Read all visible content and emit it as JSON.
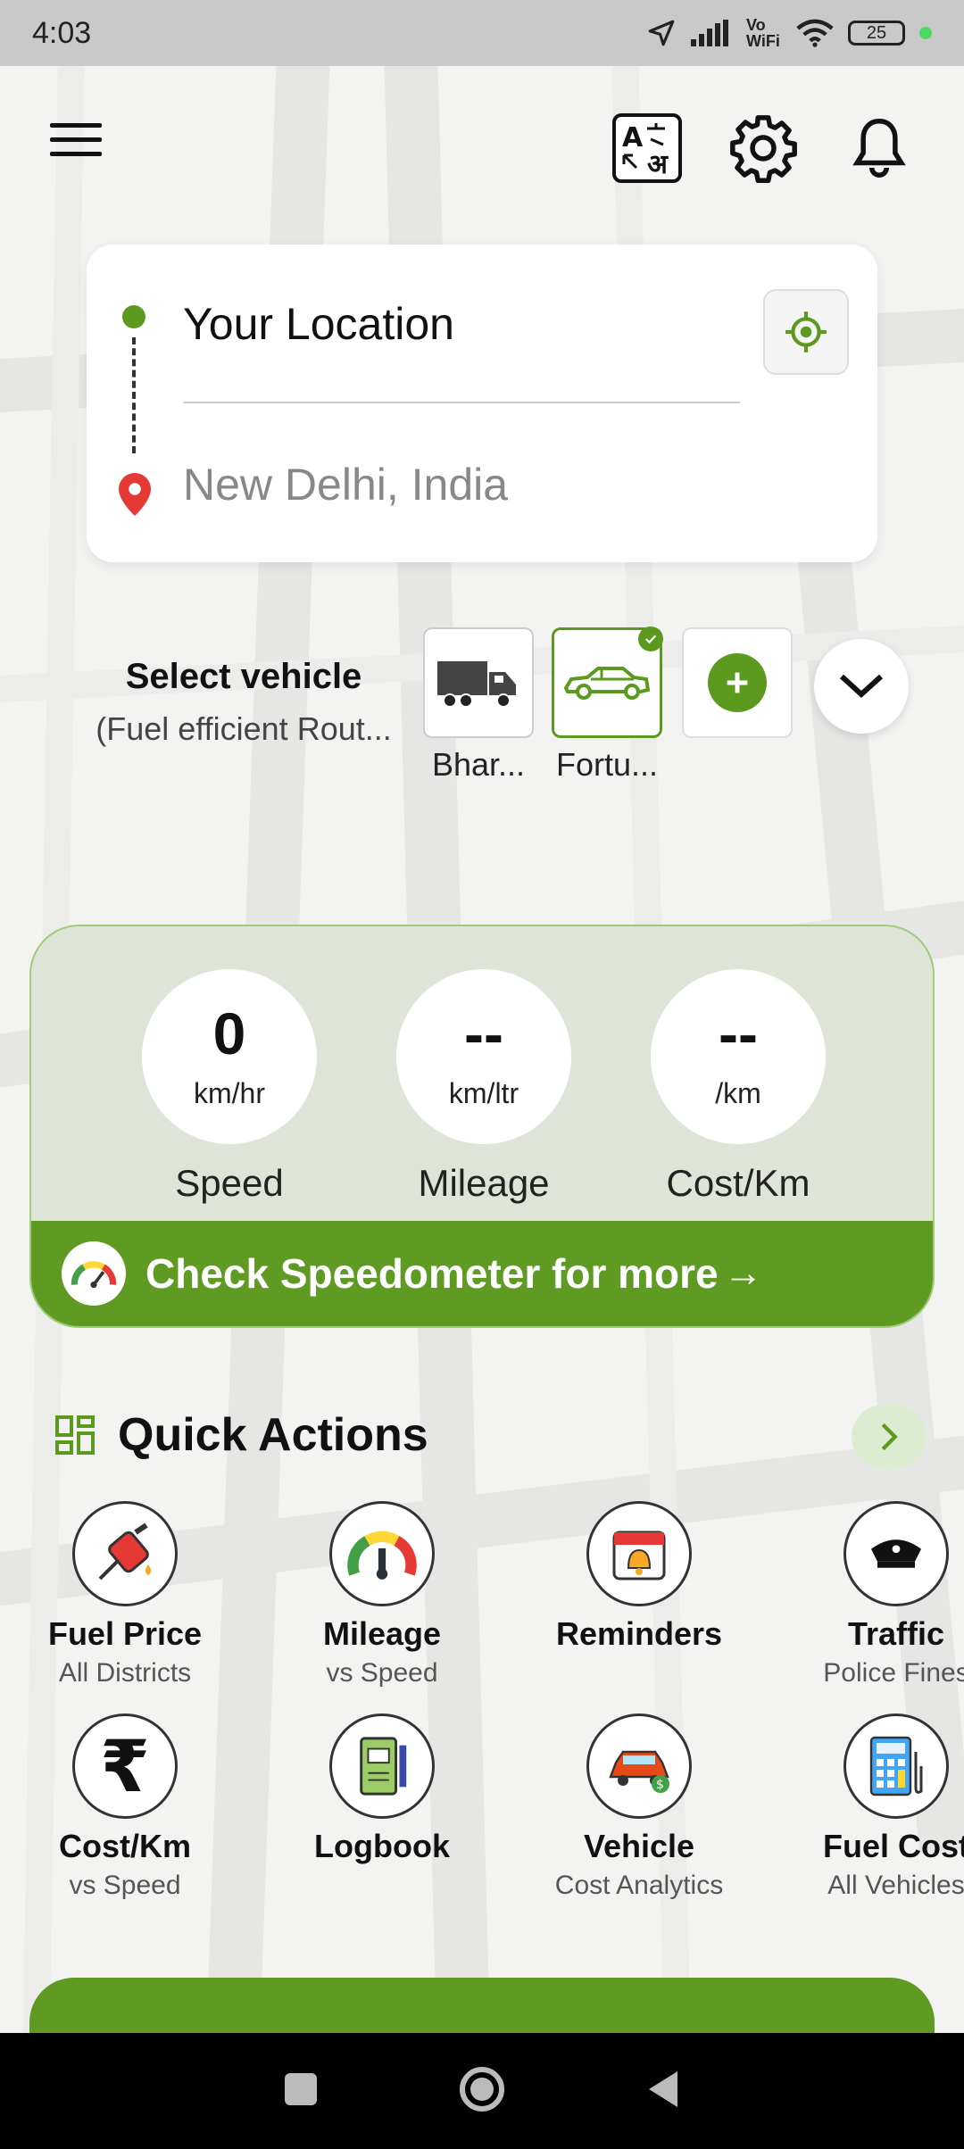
{
  "status_bar": {
    "time": "4:03",
    "battery": "25",
    "network": "Vo WiFi"
  },
  "header": {
    "menu_icon": "hamburger-menu-icon",
    "icons": [
      "translate-icon",
      "gear-icon",
      "bell-icon"
    ]
  },
  "location": {
    "from": "Your Location",
    "to": "New Delhi, India"
  },
  "vehicle": {
    "title": "Select vehicle",
    "subtitle": "(Fuel efficient Rout...",
    "tiles": [
      {
        "label": "Bhar...",
        "icon": "truck-icon",
        "selected": false
      },
      {
        "label": "Fortu...",
        "icon": "car-icon",
        "selected": true
      }
    ]
  },
  "stats": {
    "speed": {
      "value": "0",
      "unit": "km/hr",
      "label": "Speed"
    },
    "mileage": {
      "value": "--",
      "unit": "km/ltr",
      "label": "Mileage"
    },
    "cost": {
      "value": "--",
      "unit": "/km",
      "label": "Cost/Km"
    },
    "banner": "Check Speedometer for more"
  },
  "quick_actions": {
    "title": "Quick Actions",
    "items": [
      {
        "label": "Fuel Price",
        "sub": "All Districts",
        "icon": "fuel-pump-icon"
      },
      {
        "label": "Mileage",
        "sub": "vs Speed",
        "icon": "gauge-icon"
      },
      {
        "label": "Reminders",
        "sub": "",
        "icon": "calendar-bell-icon"
      },
      {
        "label": "Traffic",
        "sub": "Police Fines",
        "icon": "police-cap-icon"
      },
      {
        "label": "Cost/Km",
        "sub": "vs Speed",
        "icon": "rupee-icon"
      },
      {
        "label": "Logbook",
        "sub": "",
        "icon": "logbook-icon"
      },
      {
        "label": "Vehicle",
        "sub": "Cost Analytics",
        "icon": "car-cost-icon"
      },
      {
        "label": "Fuel Cost",
        "sub": "All Vehicles",
        "icon": "calculator-icon"
      }
    ]
  },
  "colors": {
    "accent": "#5f9a23",
    "pin": "#e53935"
  }
}
